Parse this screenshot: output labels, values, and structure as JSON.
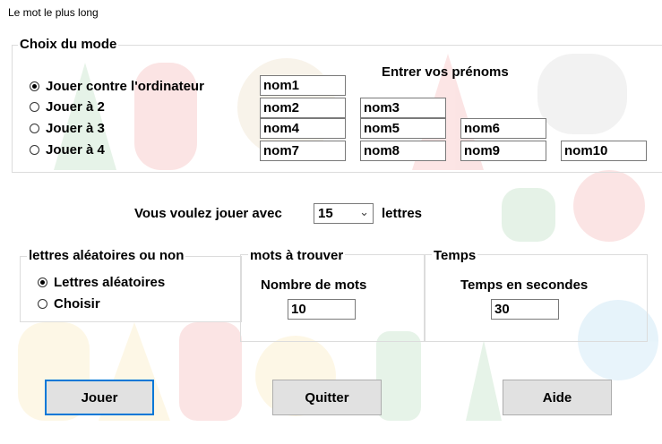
{
  "window": {
    "title": "Le mot le plus long"
  },
  "mode": {
    "title": "Choix du mode",
    "options": [
      {
        "label": "Jouer contre l'ordinateur",
        "checked": true
      },
      {
        "label": "Jouer à 2",
        "checked": false
      },
      {
        "label": "Jouer à 3",
        "checked": false
      },
      {
        "label": "Jouer à 4",
        "checked": false
      }
    ],
    "names_heading": "Entrer vos prénoms",
    "names": [
      "nom1",
      "nom2",
      "nom3",
      "nom4",
      "nom5",
      "nom6",
      "nom7",
      "nom8",
      "nom9",
      "nom10"
    ]
  },
  "letters": {
    "prefix": "Vous voulez jouer avec",
    "selected": "15",
    "suffix": "lettres"
  },
  "random_group": {
    "title": "lettres aléatoires ou non",
    "options": [
      {
        "label": "Lettres aléatoires",
        "checked": true
      },
      {
        "label": "Choisir",
        "checked": false
      }
    ]
  },
  "words_group": {
    "title": "mots à trouver",
    "label": "Nombre de mots",
    "value": "10"
  },
  "time_group": {
    "title": "Temps",
    "label": "Temps en secondes",
    "value": "30"
  },
  "buttons": {
    "play": "Jouer",
    "quit": "Quitter",
    "help": "Aide"
  },
  "colors": {
    "accent": "#0078d7",
    "button_bg": "#e1e1e1"
  }
}
